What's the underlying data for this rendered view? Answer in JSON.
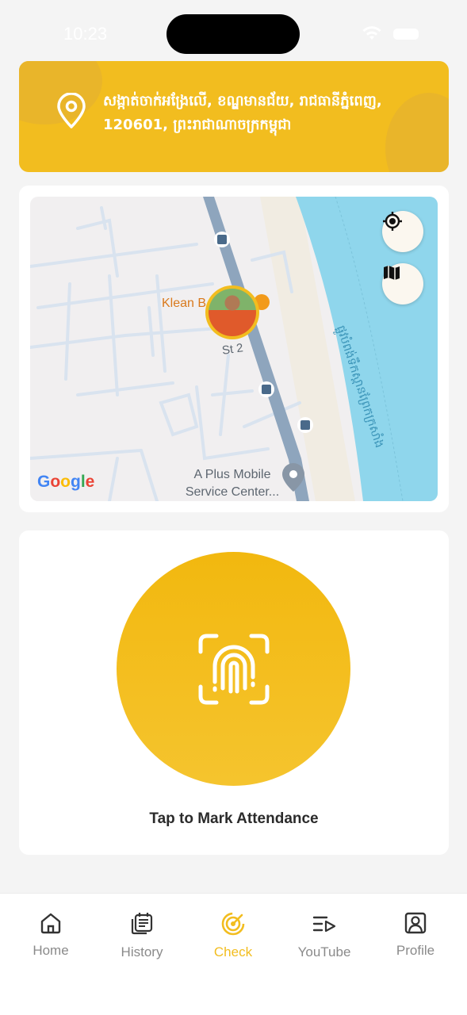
{
  "status_bar": {
    "time": "10:23"
  },
  "address": {
    "text": "សង្កាត់ចាក់អង្រែលើ, ខណ្ឌមានជ័យ, រាជធានីភ្នំពេញ, 120601, ព្រះរាជាណាចក្រកម្ពុជា"
  },
  "map": {
    "poi_name": "Klean B",
    "street": "St 2",
    "service_center": "A Plus Mobile Service Center...",
    "river_label": "ផ្លូវបំពង់ទឹកស្ពានព្រែកក្រសាំង",
    "attribution": "Google",
    "colors": {
      "water": "#8fd6ec",
      "main_road": "#8ea5bd",
      "minor_road": "#d9e3ef",
      "land": "#f1eff0"
    }
  },
  "attendance": {
    "label": "Tap to Mark Attendance",
    "accent": "#f2bd1f"
  },
  "nav": {
    "active": "check",
    "items": [
      {
        "id": "home",
        "label": "Home",
        "icon": "home-icon"
      },
      {
        "id": "history",
        "label": "History",
        "icon": "history-icon"
      },
      {
        "id": "check",
        "label": "Check",
        "icon": "check-radar-icon"
      },
      {
        "id": "youtube",
        "label": "YouTube",
        "icon": "playlist-icon"
      },
      {
        "id": "profile",
        "label": "Profile",
        "icon": "profile-icon"
      }
    ]
  }
}
